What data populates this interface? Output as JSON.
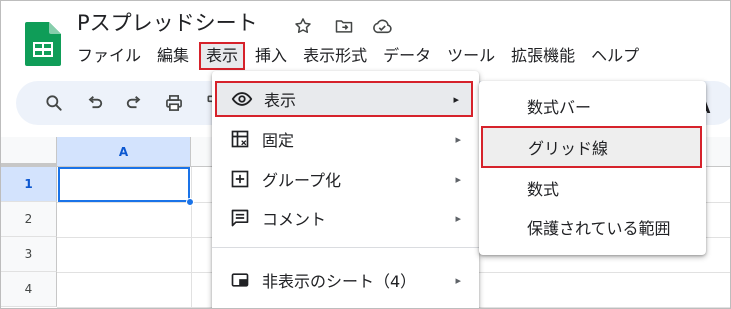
{
  "app": {
    "title": "Pスプレッドシート",
    "icons": [
      "star-icon",
      "move-to-folder-icon",
      "cloud-saved-icon"
    ]
  },
  "menubar": {
    "items": [
      "ファイル",
      "編集",
      "表示",
      "挿入",
      "表示形式",
      "データ",
      "ツール",
      "拡張機能",
      "ヘルプ"
    ],
    "active": "表示"
  },
  "toolbar": {
    "icons": [
      "search-icon",
      "undo-icon",
      "redo-icon",
      "print-icon",
      "paint-format-icon"
    ],
    "overflow": "A"
  },
  "grid": {
    "columns": [
      "A"
    ],
    "rows": [
      "1",
      "2",
      "3",
      "4"
    ],
    "selected_cell": "A1"
  },
  "view_menu": {
    "items": [
      {
        "icon": "eye-icon",
        "label": "表示",
        "has_submenu": true,
        "highlighted": true
      },
      {
        "icon": "freeze-icon",
        "label": "固定",
        "has_submenu": true
      },
      {
        "icon": "group-icon",
        "label": "グループ化",
        "has_submenu": true
      },
      {
        "icon": "comment-icon",
        "label": "コメント",
        "has_submenu": true
      },
      {
        "icon": "hidden-sheets-icon",
        "label": "非表示のシート（4）",
        "has_submenu": true
      }
    ],
    "arrow": "▸"
  },
  "show_submenu": {
    "items": [
      {
        "label": "数式バー"
      },
      {
        "label": "グリッド線",
        "highlighted": true
      },
      {
        "label": "数式"
      },
      {
        "label": "保護されている範囲"
      }
    ]
  },
  "colors": {
    "accent": "#1a73e8",
    "highlight_border": "#d6222b",
    "toolbar_bg": "#edf2fa",
    "logo_green": "#0f9d58",
    "selected_header": "#d3e3fd"
  }
}
